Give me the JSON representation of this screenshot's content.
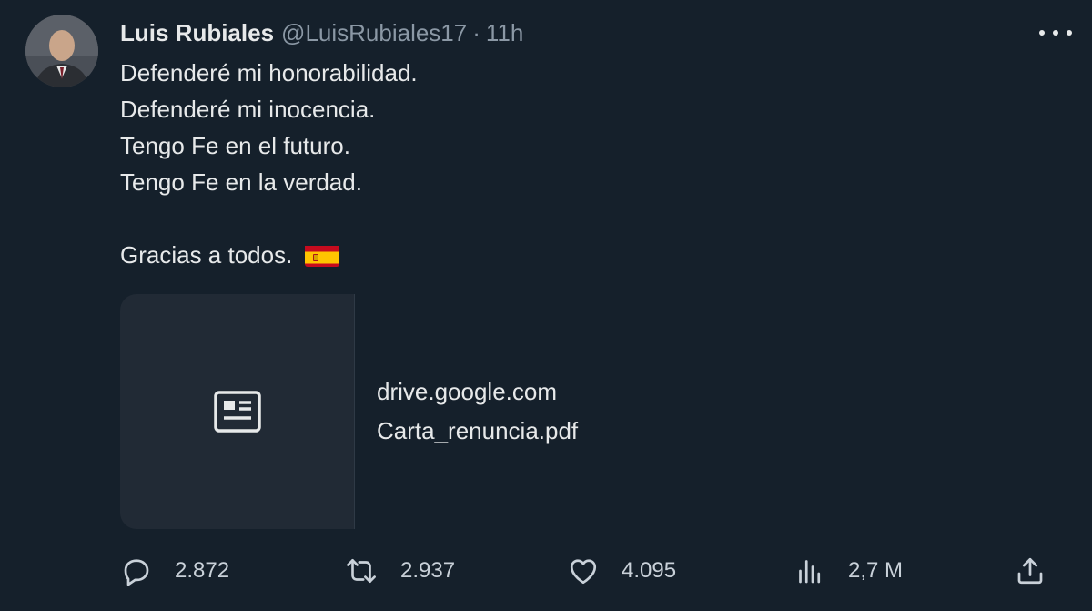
{
  "author": {
    "name": "Luis Rubiales",
    "handle": "@LuisRubiales17",
    "separator": "·",
    "time": "11h"
  },
  "tweet": {
    "lines": [
      "Defenderé mi honorabilidad.",
      "Defenderé mi inocencia.",
      "Tengo Fe en el futuro.",
      "Tengo Fe en la verdad."
    ],
    "closing": "Gracias a todos.",
    "flag_icon": "spain-flag-emoji"
  },
  "card": {
    "domain": "drive.google.com",
    "title": "Carta_renuncia.pdf",
    "icon": "article-icon"
  },
  "actions": {
    "replies": "2.872",
    "retweets": "2.937",
    "likes": "4.095",
    "views": "2,7 M"
  },
  "colors": {
    "background": "#15202b",
    "text": "#e7e9ea",
    "secondary_text": "#8b98a5",
    "card_thumb": "#212a35"
  }
}
